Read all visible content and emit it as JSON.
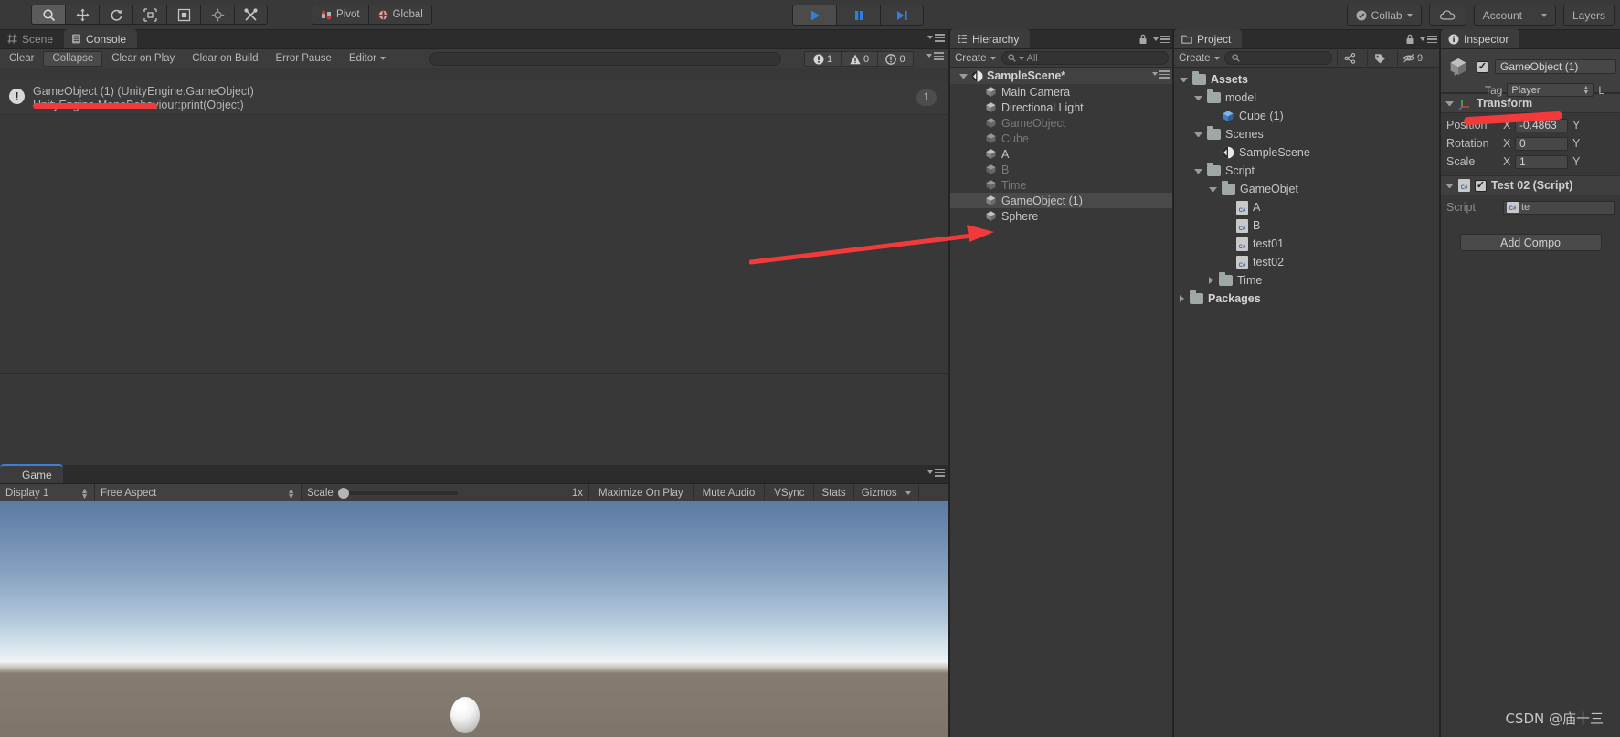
{
  "toolbar": {
    "tools": [
      {
        "name": "hand-tool",
        "icon": "hand",
        "active": true
      },
      {
        "name": "move-tool",
        "icon": "move",
        "active": false
      },
      {
        "name": "rotate-tool",
        "icon": "rotate",
        "active": false
      },
      {
        "name": "scale-tool",
        "icon": "scale",
        "active": false
      },
      {
        "name": "rect-tool",
        "icon": "rect",
        "active": false
      },
      {
        "name": "transform-tool",
        "icon": "transform",
        "active": false
      },
      {
        "name": "custom-tool",
        "icon": "wrench",
        "active": false
      }
    ],
    "pivot_label": "Pivot",
    "global_label": "Global",
    "collab_label": "Collab",
    "account_label": "Account",
    "layers_label": "Layers",
    "play_label": "Play",
    "pause_label": "Pause",
    "step_label": "Step"
  },
  "console": {
    "tabs": [
      {
        "label": "Scene",
        "icon": "scene-grid-icon",
        "active": false
      },
      {
        "label": "Console",
        "icon": "console-icon",
        "active": true
      }
    ],
    "buttons": [
      "Clear",
      "Collapse",
      "Clear on Play",
      "Clear on Build",
      "Error Pause",
      "Editor"
    ],
    "search_placeholder": "",
    "counters": [
      {
        "type": "error",
        "value": "1"
      },
      {
        "type": "warning",
        "value": "0"
      },
      {
        "type": "info",
        "value": "0"
      }
    ],
    "entries": [
      {
        "line1": "GameObject (1) (UnityEngine.GameObject)",
        "line2": "UnityEngine.MonoBehaviour:print(Object)",
        "count": "1",
        "icon": "error-icon"
      }
    ]
  },
  "game": {
    "tab_label": "Game",
    "display": "Display 1",
    "aspect": "Free Aspect",
    "scale_label": "Scale",
    "scale_value": "1x",
    "maximize_label": "Maximize On Play",
    "mute_label": "Mute Audio",
    "vsync_label": "VSync",
    "stats_label": "Stats",
    "gizmos_label": "Gizmos"
  },
  "hierarchy": {
    "tab_label": "Hierarchy",
    "create_label": "Create",
    "search_placeholder": "All",
    "scene_name": "SampleScene*",
    "items": [
      {
        "label": "Main Camera",
        "active": true,
        "selected": false
      },
      {
        "label": "Directional Light",
        "active": true,
        "selected": false
      },
      {
        "label": "GameObject",
        "active": false,
        "selected": false
      },
      {
        "label": "Cube",
        "active": false,
        "selected": false
      },
      {
        "label": "A",
        "active": true,
        "selected": false
      },
      {
        "label": "B",
        "active": false,
        "selected": false
      },
      {
        "label": "Time",
        "active": false,
        "selected": false
      },
      {
        "label": "GameObject (1)",
        "active": true,
        "selected": true
      },
      {
        "label": "Sphere",
        "active": true,
        "selected": false
      }
    ]
  },
  "project": {
    "tab_label": "Project",
    "create_label": "Create",
    "hidden_count": "9",
    "rows": [
      {
        "label": "Assets",
        "indent": 0,
        "icon": "folder",
        "arrow": "down",
        "bold": true
      },
      {
        "label": "model",
        "indent": 1,
        "icon": "folder",
        "arrow": "down",
        "bold": false
      },
      {
        "label": "Cube (1)",
        "indent": 2,
        "icon": "prefab",
        "arrow": "none",
        "bold": false
      },
      {
        "label": "Scenes",
        "indent": 1,
        "icon": "folder",
        "arrow": "down",
        "bold": false
      },
      {
        "label": "SampleScene",
        "indent": 2,
        "icon": "scene",
        "arrow": "none",
        "bold": false
      },
      {
        "label": "Script",
        "indent": 1,
        "icon": "folder",
        "arrow": "down",
        "bold": false
      },
      {
        "label": "GameObjet",
        "indent": 2,
        "icon": "folder",
        "arrow": "down",
        "bold": false
      },
      {
        "label": "A",
        "indent": 3,
        "icon": "cs",
        "arrow": "none",
        "bold": false
      },
      {
        "label": "B",
        "indent": 3,
        "icon": "cs",
        "arrow": "none",
        "bold": false
      },
      {
        "label": "test01",
        "indent": 3,
        "icon": "cs",
        "arrow": "none",
        "bold": false
      },
      {
        "label": "test02",
        "indent": 3,
        "icon": "cs",
        "arrow": "none",
        "bold": false
      },
      {
        "label": "Time",
        "indent": 2,
        "icon": "folder",
        "arrow": "right",
        "bold": false
      },
      {
        "label": "Packages",
        "indent": 0,
        "icon": "folder",
        "arrow": "right",
        "bold": true
      }
    ]
  },
  "inspector": {
    "tab_label": "Inspector",
    "object_name": "GameObject (1)",
    "tag_label": "Tag",
    "tag_value": "Player",
    "layer_label": "L",
    "transform": {
      "title": "Transform",
      "rows": [
        {
          "label": "Position",
          "x": "-0.4863",
          "axis_next": "Y"
        },
        {
          "label": "Rotation",
          "x": "0",
          "axis_next": "Y"
        },
        {
          "label": "Scale",
          "x": "1",
          "axis_next": "Y"
        }
      ],
      "axis_x": "X"
    },
    "script_component": {
      "title": "Test 02 (Script)",
      "script_label": "Script",
      "script_value": "te"
    },
    "add_component_label": "Add Compo"
  },
  "watermark": "CSDN @庙十三",
  "colors": {
    "accent_red": "#f33a3a",
    "play_blue": "#2d7fe0",
    "panel_bg": "#383838",
    "toolbar_bg": "#393939"
  }
}
